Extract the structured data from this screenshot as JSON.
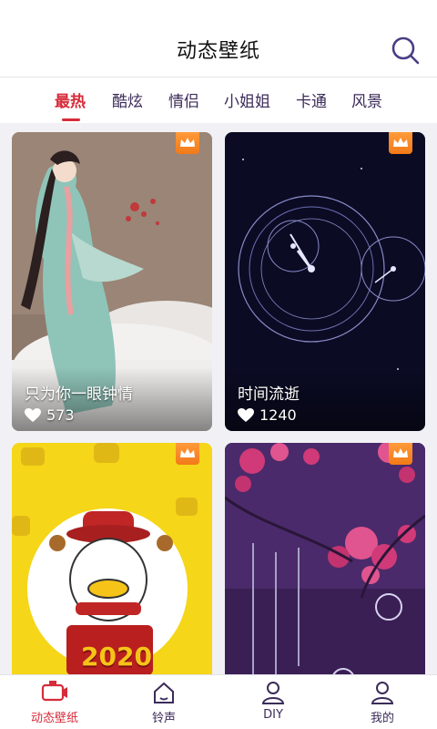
{
  "header": {
    "title": "动态壁纸"
  },
  "tabs": [
    {
      "label": "最热",
      "active": true
    },
    {
      "label": "酷炫",
      "active": false
    },
    {
      "label": "情侣",
      "active": false
    },
    {
      "label": "小姐姐",
      "active": false
    },
    {
      "label": "卡通",
      "active": false
    },
    {
      "label": "风景",
      "active": false
    }
  ],
  "wallpapers": [
    {
      "title": "只为你一眼钟情",
      "likes": "573",
      "premium": true
    },
    {
      "title": "时间流逝",
      "likes": "1240",
      "premium": true
    },
    {
      "title": "",
      "likes": "",
      "premium": true,
      "art_text": "2020"
    },
    {
      "title": "",
      "likes": "",
      "premium": true
    }
  ],
  "bottom_nav": [
    {
      "label": "动态壁纸",
      "icon": "video-icon",
      "active": true
    },
    {
      "label": "铃声",
      "icon": "home-icon",
      "active": false
    },
    {
      "label": "DIY",
      "icon": "person-icon",
      "active": false
    },
    {
      "label": "我的",
      "icon": "person-icon",
      "active": false
    }
  ],
  "colors": {
    "accent": "#d62b3a",
    "tab_text": "#3b2c59",
    "crown": "#f27a18",
    "background": "#f1f1f5"
  }
}
